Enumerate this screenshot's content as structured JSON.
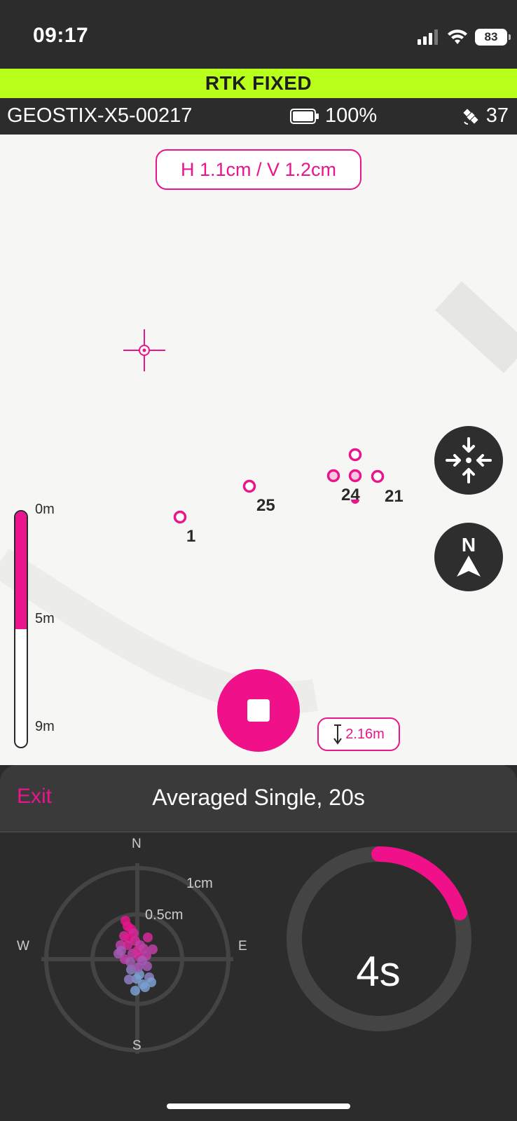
{
  "status_bar": {
    "time": "09:17",
    "battery_level": "83"
  },
  "rtk": {
    "status": "RTK FIXED"
  },
  "device": {
    "id": "GEOSTIX-X5-00217",
    "battery": "100%",
    "satellites": "37"
  },
  "map": {
    "accuracy": "H 1.1cm / V 1.2cm",
    "points": [
      {
        "label": "1"
      },
      {
        "label": "25"
      },
      {
        "label": "24"
      },
      {
        "label": "21"
      }
    ],
    "depth_scale": {
      "top": "0m",
      "mid": "5m",
      "bottom": "9m",
      "fill_fraction": 0.5
    },
    "antenna_height": "2.16m",
    "compass_letter": "N"
  },
  "sheet": {
    "exit_label": "Exit",
    "title": "Averaged Single, 20s",
    "scatter": {
      "north": "N",
      "south": "S",
      "east": "E",
      "west": "W",
      "inner_ring": "0.5cm",
      "outer_ring": "1cm"
    },
    "timer": {
      "text": "4s",
      "elapsed_seconds": 4,
      "total_seconds": 20
    }
  },
  "colors": {
    "accent": "#e8158c",
    "rtk_fixed": "#b8ff1c",
    "dark": "#2c2c2c"
  }
}
